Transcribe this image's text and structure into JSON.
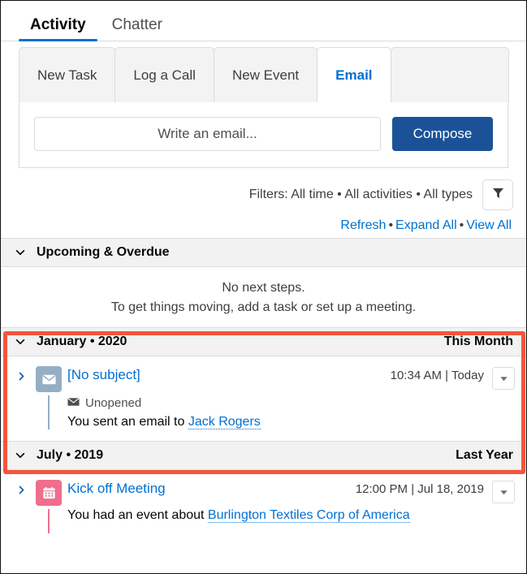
{
  "main_tabs": [
    {
      "label": "Activity",
      "active": true
    },
    {
      "label": "Chatter",
      "active": false
    }
  ],
  "sub_tabs": [
    {
      "label": "New Task",
      "active": false
    },
    {
      "label": "Log a Call",
      "active": false
    },
    {
      "label": "New Event",
      "active": false
    },
    {
      "label": "Email",
      "active": true
    }
  ],
  "compose": {
    "placeholder": "Write an email...",
    "value": "",
    "button_label": "Compose"
  },
  "filters": {
    "text": "Filters: All time • All activities • All types",
    "icon": "funnel-icon",
    "links": [
      "Refresh",
      "Expand All",
      "View All"
    ],
    "link_separator": "•"
  },
  "upcoming": {
    "title": "Upcoming & Overdue",
    "chevron": "chevron-down-icon",
    "empty_line1": "No next steps.",
    "empty_line2": "To get things moving, add a task or set up a meeting."
  },
  "sections": [
    {
      "title": "January • 2020",
      "tag": "This Month",
      "highlighted": true,
      "items": [
        {
          "icon": "email-icon",
          "icon_color": "#95aec4",
          "title": "[No subject]",
          "time": "10:34 AM | Today",
          "status_icon": "envelope-icon",
          "status": "Unopened",
          "desc_prefix": "You sent an email to ",
          "desc_link": "Jack Rogers",
          "menu_icon": "chevron-down-icon",
          "expand_icon": "chevron-right-icon"
        }
      ]
    },
    {
      "title": "July • 2019",
      "tag": "Last Year",
      "highlighted": false,
      "items": [
        {
          "icon": "calendar-icon",
          "icon_color": "#ef6e8e",
          "title": "Kick off Meeting",
          "time": "12:00 PM | Jul 18, 2019",
          "status_icon": "",
          "status": "",
          "desc_prefix": "You had an event about ",
          "desc_link": "Burlington Textiles Corp of America",
          "menu_icon": "chevron-down-icon",
          "expand_icon": "chevron-right-icon"
        }
      ]
    }
  ],
  "colors": {
    "link": "#0070d2",
    "primary_button": "#1b5297",
    "highlight_border": "#f4553d",
    "email_icon": "#95aec4",
    "event_icon": "#ef6e8e"
  }
}
